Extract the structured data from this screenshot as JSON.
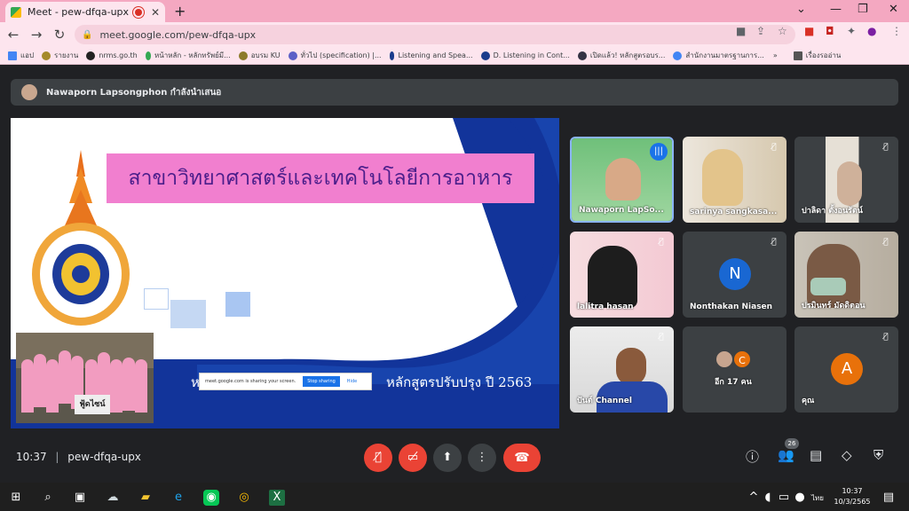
{
  "browser": {
    "tab_title": "Meet - pew-dfqa-upx",
    "url": "meet.google.com/pew-dfqa-upx",
    "bookmarks": [
      "แอป",
      "รายงาน",
      "nrms.go.th",
      "หน้าหลัก - หลักทรัพย์มี...",
      "อบรม KU",
      "ทั่วไป (specification) |...",
      "Listening and Spea...",
      "D. Listening in Cont...",
      "เปิดแล้ว! หลักสูตรอบร...",
      "สำนักงานมาตรฐานการ...",
      "เรื่องรออ่าน"
    ]
  },
  "presenter": {
    "text": "Nawaporn Lapsongphon กำลังนำเสนอ"
  },
  "slide": {
    "title": "สาขาวิทยาศาสตร์และเทคโนโลยีการอาหาร",
    "left_fragment": "ห",
    "subtitle": "หลักสูตรปรับปรุง ปี 2563",
    "photo_sign": "ฟู้ดไซน์",
    "share_info": "meet.google.com is sharing your screen.",
    "stop_sharing": "Stop sharing",
    "hide": "Hide"
  },
  "participants": [
    {
      "name": "Nawaporn LapSo...",
      "muted": false,
      "speaking": true
    },
    {
      "name": "sarinya sangkasa...",
      "muted": true
    },
    {
      "name": "ปาลิดา ตั้งอนรัตน์",
      "muted": true
    },
    {
      "name": "lalitra hasan",
      "muted": true
    },
    {
      "name": "Nonthakan Niasen",
      "muted": true,
      "initial": "N",
      "color": "#1967d2"
    },
    {
      "name": "ปรมินทร์ มัดดิตอน",
      "muted": true
    },
    {
      "name": "ปันต์ Channel",
      "muted": true
    },
    {
      "name": "อีก 17 คน",
      "initial": "C",
      "color": "#e8710a"
    },
    {
      "name": "คุณ",
      "muted": true,
      "initial": "A",
      "color": "#e8710a"
    }
  ],
  "controls": {
    "time": "10:37",
    "meeting_code": "pew-dfqa-upx",
    "participant_count": "26"
  },
  "taskbar": {
    "lang": "ไทย",
    "time": "10:37",
    "date": "10/3/2565"
  }
}
